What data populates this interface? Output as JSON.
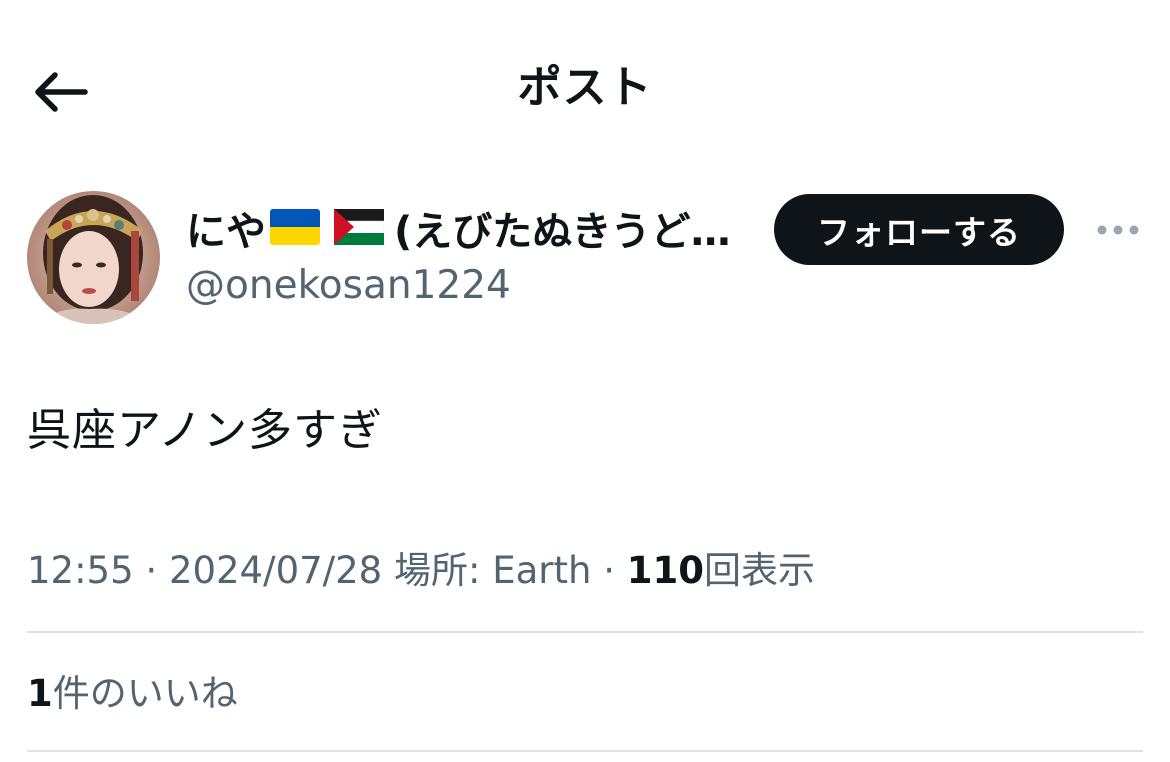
{
  "header": {
    "title": "ポスト",
    "back_icon": "arrow-left-icon"
  },
  "author": {
    "display_name_prefix": "にや",
    "display_name_flags": [
      "ukraine-flag-emoji",
      "palestine-flag-emoji"
    ],
    "display_name_rest": "(えびたぬきうど…",
    "handle": "@onekosan1224",
    "follow_label": "フォローする",
    "more_icon": "more-horizontal-icon"
  },
  "post": {
    "text": "呉座アノン多すぎ"
  },
  "meta": {
    "time": "12:55",
    "sep1": "·",
    "date": "2024/07/28",
    "location_label": "場所: Earth",
    "sep2": "·",
    "views_count": "110",
    "views_label": "回表示"
  },
  "engagement": {
    "likes_count": "1",
    "likes_label": "件のいいね"
  },
  "colors": {
    "text_primary": "#0f1419",
    "text_secondary": "#536471",
    "divider": "#dde2e6",
    "follow_bg": "#0f1419",
    "ukraine_blue": "#0057b7",
    "ukraine_yellow": "#ffd700",
    "palestine_red": "#ce1126",
    "palestine_green": "#007a3d"
  }
}
